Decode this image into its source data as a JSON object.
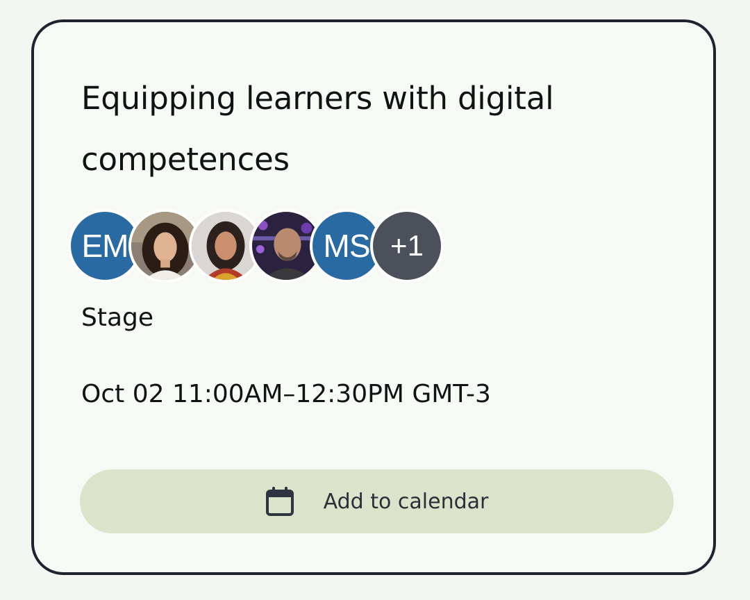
{
  "event": {
    "title": "Equipping learners with digital competences",
    "location": "Stage",
    "datetime": "Oct 02 11:00AM–12:30PM GMT-3"
  },
  "speakers": {
    "items": [
      {
        "type": "initials",
        "text": "EM",
        "color": "#2a6aa3"
      },
      {
        "type": "photo",
        "name": "speaker-photo-1"
      },
      {
        "type": "photo",
        "name": "speaker-photo-2"
      },
      {
        "type": "photo",
        "name": "speaker-photo-3"
      },
      {
        "type": "initials",
        "text": "MS",
        "color": "#2a6aa3"
      }
    ],
    "more_label": "+1"
  },
  "actions": {
    "add_to_calendar_label": "Add to calendar",
    "add_to_calendar_icon": "calendar-icon"
  },
  "colors": {
    "card_border": "#1d2430",
    "button_bg": "#dbe4cb",
    "more_badge": "#4c505a"
  }
}
